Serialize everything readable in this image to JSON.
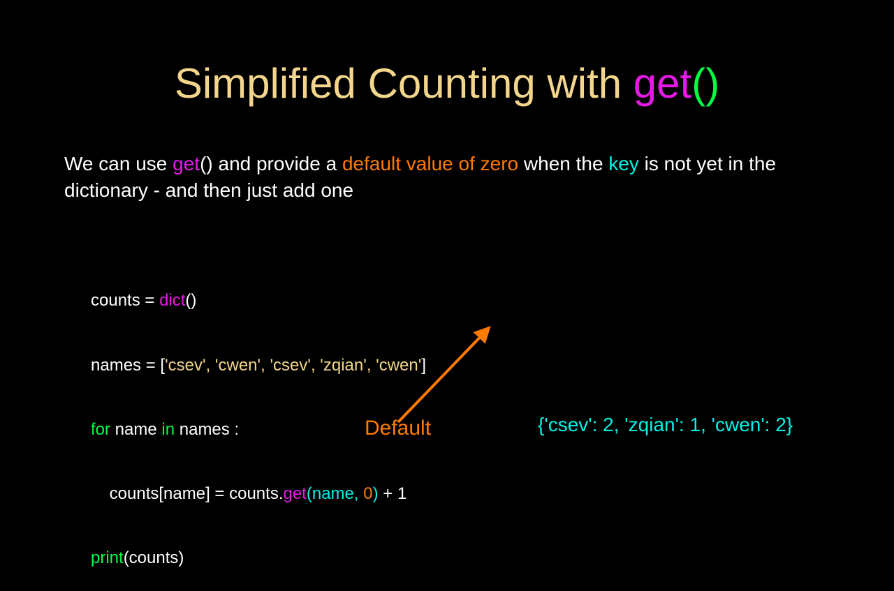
{
  "title": {
    "plain": "Simplified Counting with ",
    "get": "get",
    "parens": "()"
  },
  "description": {
    "p1": "We can use ",
    "get": "get",
    "p2": "() and provide a ",
    "default_val": "default value of zero",
    "p3": " when the ",
    "key": "key",
    "p4": " is not yet in the dictionary - and then just add one"
  },
  "code": {
    "l1a": "counts = ",
    "l1b": "dict",
    "l1c": "()",
    "l2a": "names = [",
    "l2b": "'csev', 'cwen', 'csev', 'zqian', 'cwen'",
    "l2c": "]",
    "l3a": "for",
    "l3b": " name ",
    "l3c": "in",
    "l3d": " names :",
    "l4a": "    counts[name] = counts.",
    "l4b": "get",
    "l4c": "(name, ",
    "l4d": "0",
    "l4e": ")",
    "l4f": " + 1",
    "l5a": "print",
    "l5b": "(counts)"
  },
  "defaultLabel": "Default",
  "output": "{'csev': 2, 'zqian': 1, 'cwen': 2}"
}
